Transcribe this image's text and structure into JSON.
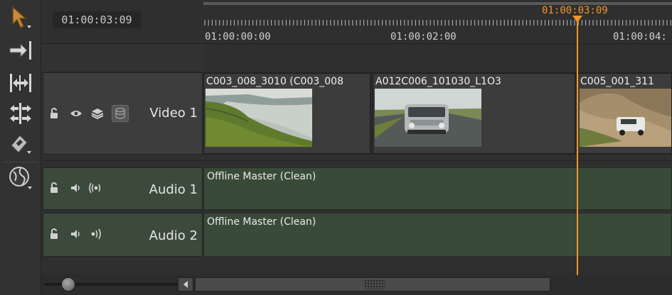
{
  "colors": {
    "accent": "#f0962a",
    "audio_green": "#394a39"
  },
  "header": {
    "timecode": "01:00:03:09"
  },
  "ruler": {
    "labels": [
      "01:00:00:00",
      "01:00:02:00",
      "01:00:04:"
    ],
    "playhead_time": "01:00:03:09"
  },
  "toolbar": {
    "tools": [
      "select-tool-icon",
      "insert-tool-icon",
      "ripple-tool-icon",
      "slip-tool-icon",
      "razor-tool-icon",
      "render-globe-icon"
    ]
  },
  "tracks": {
    "video1": {
      "name": "Video 1"
    },
    "audio1": {
      "name": "Audio 1"
    },
    "audio2": {
      "name": "Audio 2"
    }
  },
  "clips": {
    "video": [
      {
        "title": "C003_008_3010 (C003_008",
        "thumb": "coastal-cliff-sea"
      },
      {
        "title": "A012C006_101030_L1O3",
        "thumb": "suv-front-road"
      },
      {
        "title": "C005_001_311",
        "thumb": "suv-rocky-terrain"
      }
    ],
    "audio1": {
      "title": "Offline Master (Clean)"
    },
    "audio2": {
      "title": "Offline Master (Clean)"
    }
  }
}
